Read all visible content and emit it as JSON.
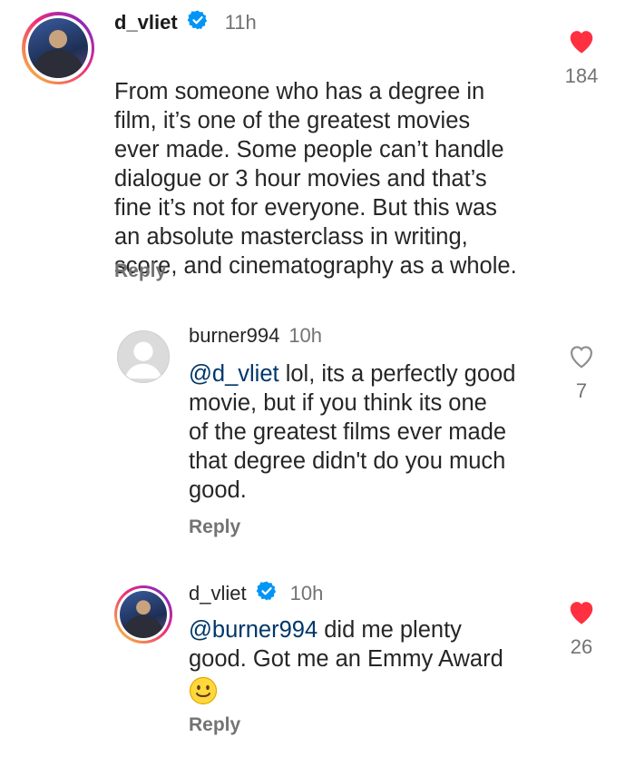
{
  "colors": {
    "like_red": "#ff3040",
    "verified_blue": "#0095f6",
    "mention": "#00376b",
    "secondary": "#737373"
  },
  "comments": [
    {
      "username": "d_vliet",
      "verified": true,
      "time": "11h",
      "text": "From someone who has a degree in\nfilm, it’s one of the greatest movies\never made. Some people can’t handle\ndialogue or 3 hour movies and that’s\nfine it’s not for everyone. But this was\nan absolute masterclass in writing,\nscore, and cinematography as a whole.",
      "reply_label": "Reply",
      "likes": "184",
      "liked": true
    },
    {
      "username": "burner994",
      "verified": false,
      "time": "10h",
      "mention": "@d_vliet",
      "text": " lol, its a perfectly good\nmovie, but if you think its one\nof the greatest films ever made\nthat degree didn't do you much\ngood.",
      "reply_label": "Reply",
      "likes": "7",
      "liked": false
    },
    {
      "username": "d_vliet",
      "verified": true,
      "time": "10h",
      "mention": "@burner994",
      "text": " did me plenty\ngood. Got me an Emmy Award",
      "emoji": "slightly-smiling-face-icon",
      "reply_label": "Reply",
      "likes": "26",
      "liked": true
    }
  ]
}
